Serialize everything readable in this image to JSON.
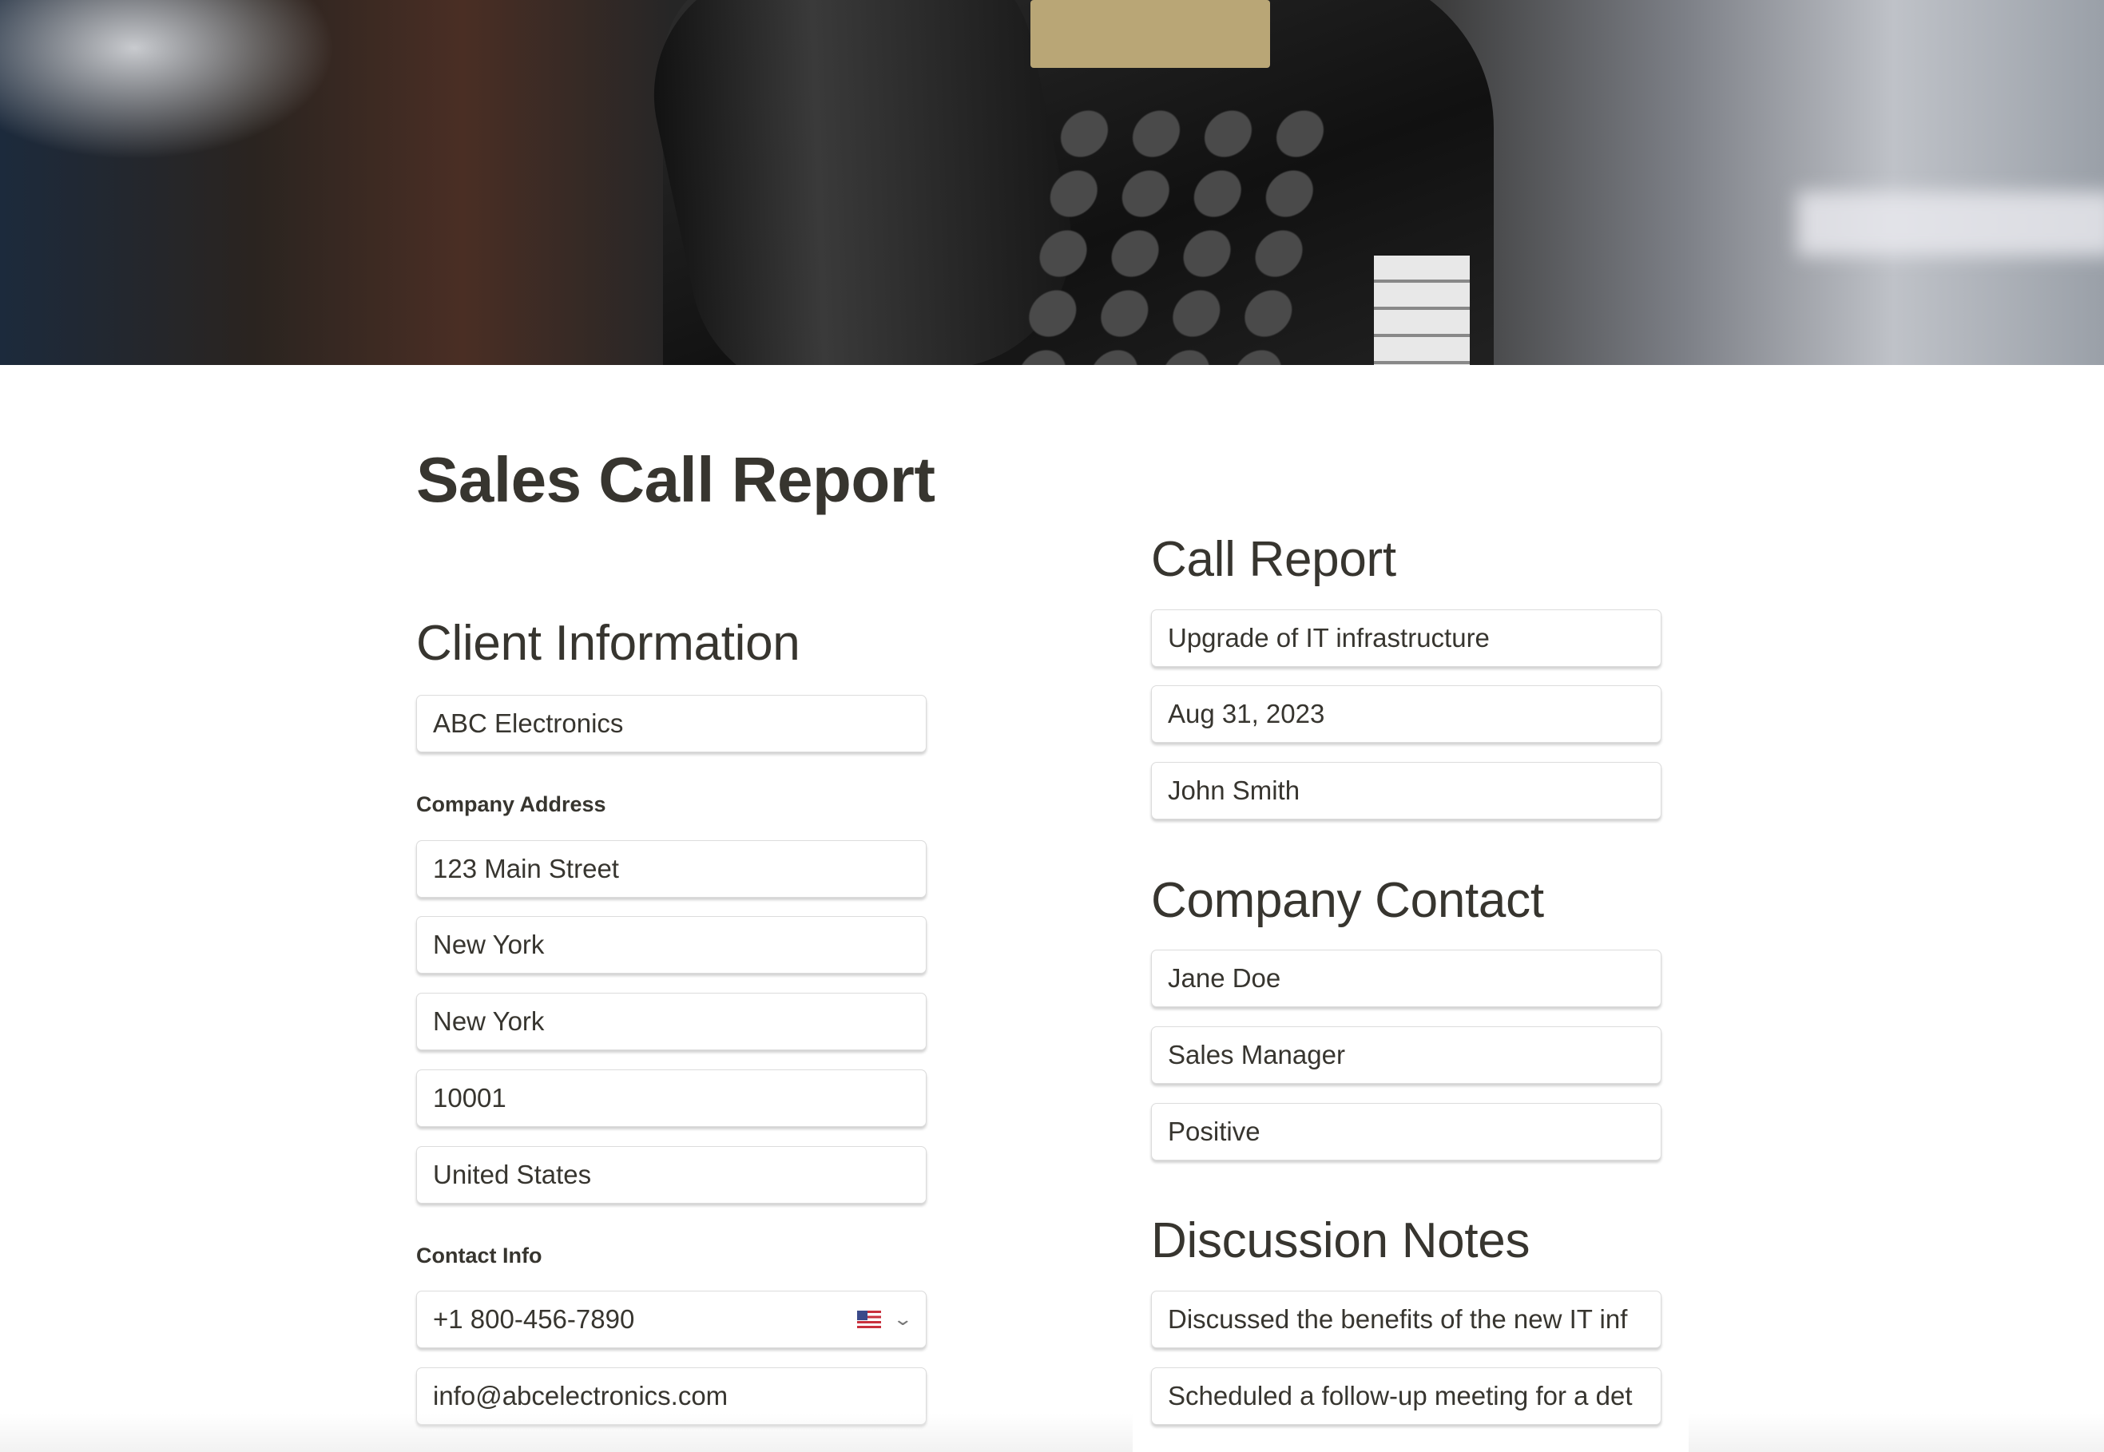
{
  "page": {
    "title": "Sales Call Report"
  },
  "client_information": {
    "heading": "Client Information",
    "company_name": "ABC Electronics",
    "address_label": "Company Address",
    "street": "123 Main Street",
    "city": "New York",
    "state": "New York",
    "zip": "10001",
    "country": "United States",
    "contact_label": "Contact Info",
    "phone": "+1 800-456-7890",
    "phone_country_icon": "us-flag-icon",
    "email": "info@abcelectronics.com"
  },
  "call_report": {
    "heading": "Call Report",
    "topic": "Upgrade of IT infrastructure",
    "date": "Aug 31, 2023",
    "rep": "John Smith"
  },
  "company_contact": {
    "heading": "Company Contact",
    "name": "Jane Doe",
    "title": "Sales Manager",
    "outcome": "Positive"
  },
  "discussion_notes": {
    "heading": "Discussion Notes",
    "note1": "Discussed the benefits of the new IT inf",
    "note2": "Scheduled a follow-up meeting for a det"
  }
}
